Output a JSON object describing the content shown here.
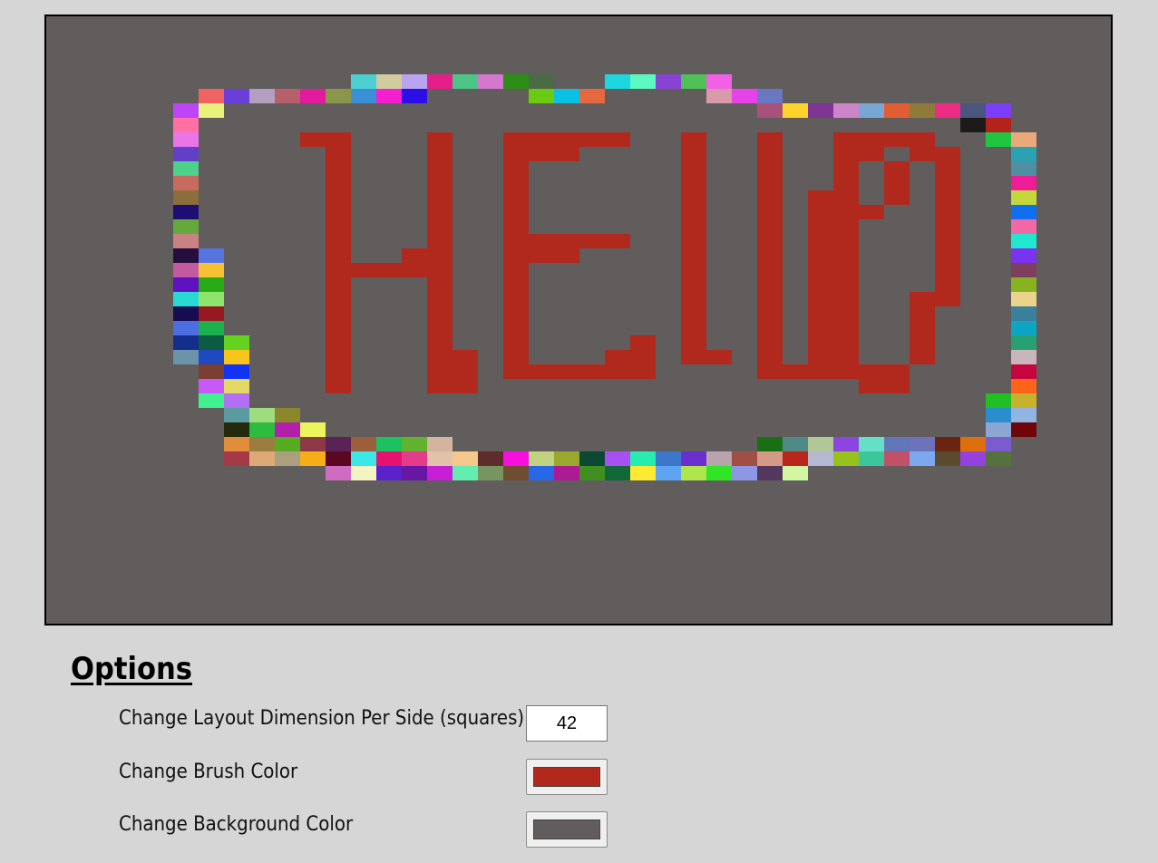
{
  "canvas": {
    "background_color": "#625d5d",
    "brush_color": "#b1281d",
    "cells": [
      {
        "col": 12,
        "row": 4,
        "color": "#4ccfd1"
      },
      {
        "col": 13,
        "row": 4,
        "color": "#d2cb9f"
      },
      {
        "col": 14,
        "row": 4,
        "color": "#b9a4f0"
      },
      {
        "col": 15,
        "row": 4,
        "color": "#e51f8a"
      },
      {
        "col": 16,
        "row": 4,
        "color": "#4cc587"
      },
      {
        "col": 17,
        "row": 4,
        "color": "#d576cf"
      },
      {
        "col": 18,
        "row": 4,
        "color": "#2e8d16"
      },
      {
        "col": 19,
        "row": 4,
        "color": "#4b6b45"
      },
      {
        "col": 22,
        "row": 4,
        "color": "#1dd7e0"
      },
      {
        "col": 23,
        "row": 4,
        "color": "#5cf9c3"
      },
      {
        "col": 24,
        "row": 4,
        "color": "#8843d5"
      },
      {
        "col": 25,
        "row": 4,
        "color": "#4fc157"
      },
      {
        "col": 26,
        "row": 4,
        "color": "#f260e6"
      },
      {
        "col": 6,
        "row": 5,
        "color": "#ef6363"
      },
      {
        "col": 7,
        "row": 5,
        "color": "#6a3fd9"
      },
      {
        "col": 8,
        "row": 5,
        "color": "#b29fc2"
      },
      {
        "col": 9,
        "row": 5,
        "color": "#b5606b"
      },
      {
        "col": 10,
        "row": 5,
        "color": "#e11a9e"
      },
      {
        "col": 11,
        "row": 5,
        "color": "#8a974b"
      },
      {
        "col": 12,
        "row": 5,
        "color": "#3a8fd7"
      },
      {
        "col": 13,
        "row": 5,
        "color": "#f41fce"
      },
      {
        "col": 14,
        "row": 5,
        "color": "#2b0fe6"
      },
      {
        "col": 19,
        "row": 5,
        "color": "#6bca12"
      },
      {
        "col": 20,
        "row": 5,
        "color": "#0cc0e3"
      },
      {
        "col": 21,
        "row": 5,
        "color": "#e46840"
      },
      {
        "col": 26,
        "row": 5,
        "color": "#d69aa9"
      },
      {
        "col": 27,
        "row": 5,
        "color": "#e642e8"
      },
      {
        "col": 28,
        "row": 5,
        "color": "#6a77c1"
      },
      {
        "col": 5,
        "row": 6,
        "color": "#bd44f7"
      },
      {
        "col": 6,
        "row": 6,
        "color": "#e8f27b"
      },
      {
        "col": 28,
        "row": 6,
        "color": "#a8527a"
      },
      {
        "col": 29,
        "row": 6,
        "color": "#ffd22c"
      },
      {
        "col": 30,
        "row": 6,
        "color": "#7e3593"
      },
      {
        "col": 31,
        "row": 6,
        "color": "#cc85c8"
      },
      {
        "col": 32,
        "row": 6,
        "color": "#7aa6d6"
      },
      {
        "col": 33,
        "row": 6,
        "color": "#e35d33"
      },
      {
        "col": 34,
        "row": 6,
        "color": "#8f7a39"
      },
      {
        "col": 35,
        "row": 6,
        "color": "#ee2c86"
      },
      {
        "col": 36,
        "row": 6,
        "color": "#4b5680"
      },
      {
        "col": 37,
        "row": 6,
        "color": "#7b3ef9"
      },
      {
        "col": 5,
        "row": 7,
        "color": "#ff6fa3"
      },
      {
        "col": 36,
        "row": 7,
        "color": "#1d1a1a"
      },
      {
        "col": 37,
        "row": 7,
        "color": "#b4221c"
      },
      {
        "col": 5,
        "row": 8,
        "color": "#e975e9"
      },
      {
        "col": 37,
        "row": 8,
        "color": "#20c640"
      },
      {
        "col": 38,
        "row": 8,
        "color": "#eaa97b"
      },
      {
        "col": 5,
        "row": 9,
        "color": "#6040c8"
      },
      {
        "col": 38,
        "row": 9,
        "color": "#2ba2b4"
      },
      {
        "col": 5,
        "row": 10,
        "color": "#4dd08a"
      },
      {
        "col": 38,
        "row": 10,
        "color": "#4e8fa1"
      },
      {
        "col": 5,
        "row": 11,
        "color": "#c96a61"
      },
      {
        "col": 38,
        "row": 11,
        "color": "#ee1c96"
      },
      {
        "col": 5,
        "row": 12,
        "color": "#8c6d3c"
      },
      {
        "col": 38,
        "row": 12,
        "color": "#c4d83b"
      },
      {
        "col": 5,
        "row": 13,
        "color": "#1e0e74"
      },
      {
        "col": 38,
        "row": 13,
        "color": "#0f6ff0"
      },
      {
        "col": 5,
        "row": 14,
        "color": "#66a83c"
      },
      {
        "col": 38,
        "row": 14,
        "color": "#f168a4"
      },
      {
        "col": 5,
        "row": 15,
        "color": "#c88283"
      },
      {
        "col": 38,
        "row": 15,
        "color": "#21e9cf"
      },
      {
        "col": 5,
        "row": 16,
        "color": "#250f3f"
      },
      {
        "col": 6,
        "row": 16,
        "color": "#5574e0"
      },
      {
        "col": 38,
        "row": 16,
        "color": "#7a33ef"
      },
      {
        "col": 5,
        "row": 17,
        "color": "#c15aa1"
      },
      {
        "col": 6,
        "row": 17,
        "color": "#f6c132"
      },
      {
        "col": 38,
        "row": 17,
        "color": "#7e3e5d"
      },
      {
        "col": 5,
        "row": 18,
        "color": "#5e12bf"
      },
      {
        "col": 6,
        "row": 18,
        "color": "#28a916"
      },
      {
        "col": 38,
        "row": 18,
        "color": "#88b321"
      },
      {
        "col": 5,
        "row": 19,
        "color": "#27dbd3"
      },
      {
        "col": 6,
        "row": 19,
        "color": "#8ee56d"
      },
      {
        "col": 38,
        "row": 19,
        "color": "#ebd38c"
      },
      {
        "col": 5,
        "row": 20,
        "color": "#180c51"
      },
      {
        "col": 6,
        "row": 20,
        "color": "#961820"
      },
      {
        "col": 38,
        "row": 20,
        "color": "#3a7f9b"
      },
      {
        "col": 5,
        "row": 21,
        "color": "#4d6ee0"
      },
      {
        "col": 6,
        "row": 21,
        "color": "#1eb04d"
      },
      {
        "col": 38,
        "row": 21,
        "color": "#0ea5c4"
      },
      {
        "col": 5,
        "row": 22,
        "color": "#142f8b"
      },
      {
        "col": 6,
        "row": 22,
        "color": "#0d5b43"
      },
      {
        "col": 7,
        "row": 22,
        "color": "#64d21e"
      },
      {
        "col": 38,
        "row": 22,
        "color": "#27a074"
      },
      {
        "col": 5,
        "row": 23,
        "color": "#6b93a9"
      },
      {
        "col": 6,
        "row": 23,
        "color": "#2049c1"
      },
      {
        "col": 7,
        "row": 23,
        "color": "#fac51a"
      },
      {
        "col": 38,
        "row": 23,
        "color": "#c9b6bc"
      },
      {
        "col": 6,
        "row": 24,
        "color": "#7b3f31"
      },
      {
        "col": 7,
        "row": 24,
        "color": "#1232f4"
      },
      {
        "col": 38,
        "row": 24,
        "color": "#c5053d"
      },
      {
        "col": 6,
        "row": 25,
        "color": "#c659f7"
      },
      {
        "col": 7,
        "row": 25,
        "color": "#e2d966"
      },
      {
        "col": 38,
        "row": 25,
        "color": "#fd6419"
      },
      {
        "col": 6,
        "row": 26,
        "color": "#3ef18e"
      },
      {
        "col": 7,
        "row": 26,
        "color": "#b26ff3"
      },
      {
        "col": 37,
        "row": 26,
        "color": "#20c025"
      },
      {
        "col": 38,
        "row": 26,
        "color": "#c7b22e"
      },
      {
        "col": 7,
        "row": 27,
        "color": "#5a9aa0"
      },
      {
        "col": 8,
        "row": 27,
        "color": "#9ddc7f"
      },
      {
        "col": 9,
        "row": 27,
        "color": "#8b872a"
      },
      {
        "col": 37,
        "row": 27,
        "color": "#2a8ecd"
      },
      {
        "col": 38,
        "row": 27,
        "color": "#91b4e2"
      },
      {
        "col": 7,
        "row": 28,
        "color": "#262a0d"
      },
      {
        "col": 8,
        "row": 28,
        "color": "#2bbc40"
      },
      {
        "col": 9,
        "row": 28,
        "color": "#b21fa8"
      },
      {
        "col": 10,
        "row": 28,
        "color": "#ecf65c"
      },
      {
        "col": 37,
        "row": 28,
        "color": "#8ba6d2"
      },
      {
        "col": 38,
        "row": 28,
        "color": "#6f0509"
      },
      {
        "col": 7,
        "row": 29,
        "color": "#e08e3b"
      },
      {
        "col": 8,
        "row": 29,
        "color": "#9b7c41"
      },
      {
        "col": 9,
        "row": 29,
        "color": "#55ac21"
      },
      {
        "col": 10,
        "row": 29,
        "color": "#8d3a46"
      },
      {
        "col": 11,
        "row": 29,
        "color": "#5b2256"
      },
      {
        "col": 12,
        "row": 29,
        "color": "#9d5e3b"
      },
      {
        "col": 13,
        "row": 29,
        "color": "#1cc162"
      },
      {
        "col": 14,
        "row": 29,
        "color": "#62b230"
      },
      {
        "col": 15,
        "row": 29,
        "color": "#d4b49f"
      },
      {
        "col": 28,
        "row": 29,
        "color": "#1a6e14"
      },
      {
        "col": 29,
        "row": 29,
        "color": "#4f8a86"
      },
      {
        "col": 30,
        "row": 29,
        "color": "#b1c797"
      },
      {
        "col": 31,
        "row": 29,
        "color": "#8c45de"
      },
      {
        "col": 32,
        "row": 29,
        "color": "#63e0c5"
      },
      {
        "col": 33,
        "row": 29,
        "color": "#6276b8"
      },
      {
        "col": 34,
        "row": 29,
        "color": "#6d72bb"
      },
      {
        "col": 35,
        "row": 29,
        "color": "#6c2412"
      },
      {
        "col": 36,
        "row": 29,
        "color": "#dc6f0b"
      },
      {
        "col": 37,
        "row": 29,
        "color": "#7a5ccf"
      },
      {
        "col": 7,
        "row": 30,
        "color": "#a43a48"
      },
      {
        "col": 8,
        "row": 30,
        "color": "#ddaa77"
      },
      {
        "col": 9,
        "row": 30,
        "color": "#ac9f7e"
      },
      {
        "col": 10,
        "row": 30,
        "color": "#f7ae16"
      },
      {
        "col": 11,
        "row": 30,
        "color": "#5c0722"
      },
      {
        "col": 12,
        "row": 30,
        "color": "#3ae8e8"
      },
      {
        "col": 13,
        "row": 30,
        "color": "#e5126f"
      },
      {
        "col": 14,
        "row": 30,
        "color": "#e43c8a"
      },
      {
        "col": 15,
        "row": 30,
        "color": "#e0c3aa"
      },
      {
        "col": 16,
        "row": 30,
        "color": "#f6c88c"
      },
      {
        "col": 17,
        "row": 30,
        "color": "#5e2d2b"
      },
      {
        "col": 18,
        "row": 30,
        "color": "#f710dd"
      },
      {
        "col": 19,
        "row": 30,
        "color": "#c1d37f"
      },
      {
        "col": 20,
        "row": 30,
        "color": "#9aa92d"
      },
      {
        "col": 21,
        "row": 30,
        "color": "#0c4933"
      },
      {
        "col": 22,
        "row": 30,
        "color": "#a950f4"
      },
      {
        "col": 23,
        "row": 30,
        "color": "#27ecaf"
      },
      {
        "col": 24,
        "row": 30,
        "color": "#3c77cb"
      },
      {
        "col": 25,
        "row": 30,
        "color": "#6a2fcf"
      },
      {
        "col": 26,
        "row": 30,
        "color": "#b9a3ad"
      },
      {
        "col": 27,
        "row": 30,
        "color": "#a14f43"
      },
      {
        "col": 28,
        "row": 30,
        "color": "#d59a87"
      },
      {
        "col": 29,
        "row": 30,
        "color": "#b8261c"
      },
      {
        "col": 30,
        "row": 30,
        "color": "#b4b8d0"
      },
      {
        "col": 31,
        "row": 30,
        "color": "#96c21b"
      },
      {
        "col": 32,
        "row": 30,
        "color": "#3dc69b"
      },
      {
        "col": 33,
        "row": 30,
        "color": "#c15167"
      },
      {
        "col": 34,
        "row": 30,
        "color": "#7ba8ee"
      },
      {
        "col": 35,
        "row": 30,
        "color": "#5a4a2e"
      },
      {
        "col": 36,
        "row": 30,
        "color": "#9342dd"
      },
      {
        "col": 37,
        "row": 30,
        "color": "#55713d"
      },
      {
        "col": 11,
        "row": 31,
        "color": "#ce6cc1"
      },
      {
        "col": 12,
        "row": 31,
        "color": "#f2f4c1"
      },
      {
        "col": 13,
        "row": 31,
        "color": "#5a22cd"
      },
      {
        "col": 14,
        "row": 31,
        "color": "#6816a4"
      },
      {
        "col": 15,
        "row": 31,
        "color": "#c71fd5"
      },
      {
        "col": 16,
        "row": 31,
        "color": "#63edb0"
      },
      {
        "col": 17,
        "row": 31,
        "color": "#779462"
      },
      {
        "col": 18,
        "row": 31,
        "color": "#6f4d31"
      },
      {
        "col": 19,
        "row": 31,
        "color": "#2867e8"
      },
      {
        "col": 20,
        "row": 31,
        "color": "#ad1a94"
      },
      {
        "col": 21,
        "row": 31,
        "color": "#3f9020"
      },
      {
        "col": 22,
        "row": 31,
        "color": "#116839"
      },
      {
        "col": 23,
        "row": 31,
        "color": "#fcea33"
      },
      {
        "col": 24,
        "row": 31,
        "color": "#5ea4f3"
      },
      {
        "col": 25,
        "row": 31,
        "color": "#aee54b"
      },
      {
        "col": 26,
        "row": 31,
        "color": "#30e525"
      },
      {
        "col": 27,
        "row": 31,
        "color": "#8e96e6"
      },
      {
        "col": 28,
        "row": 31,
        "color": "#54375d"
      },
      {
        "col": 29,
        "row": 31,
        "color": "#d3f7a0"
      }
    ],
    "brush_cells": [
      {
        "row": 8,
        "cols": [
          10,
          11,
          15,
          18,
          19,
          20,
          21,
          22,
          25,
          28,
          31,
          32,
          33,
          34
        ]
      },
      {
        "row": 9,
        "cols": [
          11,
          15,
          18,
          19,
          20,
          25,
          28,
          31,
          32,
          34,
          35
        ]
      },
      {
        "row": 10,
        "cols": [
          11,
          15,
          18,
          25,
          28,
          31,
          33,
          35
        ]
      },
      {
        "row": 11,
        "cols": [
          11,
          15,
          18,
          25,
          28,
          31,
          33,
          35
        ]
      },
      {
        "row": 12,
        "cols": [
          11,
          15,
          18,
          25,
          28,
          30,
          31,
          33,
          35
        ]
      },
      {
        "row": 13,
        "cols": [
          11,
          15,
          18,
          25,
          28,
          30,
          31,
          32,
          35
        ]
      },
      {
        "row": 14,
        "cols": [
          11,
          15,
          18,
          25,
          28,
          30,
          31,
          35
        ]
      },
      {
        "row": 15,
        "cols": [
          11,
          15,
          18,
          19,
          20,
          21,
          22,
          25,
          28,
          30,
          31,
          35
        ]
      },
      {
        "row": 16,
        "cols": [
          11,
          14,
          15,
          18,
          19,
          20,
          25,
          28,
          30,
          31,
          35
        ]
      },
      {
        "row": 17,
        "cols": [
          11,
          12,
          13,
          14,
          15,
          18,
          25,
          28,
          30,
          31,
          35
        ]
      },
      {
        "row": 18,
        "cols": [
          11,
          15,
          18,
          25,
          28,
          30,
          31,
          35
        ]
      },
      {
        "row": 19,
        "cols": [
          11,
          15,
          18,
          25,
          28,
          30,
          31,
          34,
          35
        ]
      },
      {
        "row": 20,
        "cols": [
          11,
          15,
          18,
          25,
          28,
          30,
          31,
          34
        ]
      },
      {
        "row": 21,
        "cols": [
          11,
          15,
          18,
          25,
          28,
          30,
          31,
          34
        ]
      },
      {
        "row": 22,
        "cols": [
          11,
          15,
          18,
          23,
          25,
          28,
          30,
          31,
          34
        ]
      },
      {
        "row": 23,
        "cols": [
          11,
          15,
          16,
          18,
          22,
          23,
          25,
          26,
          28,
          30,
          31,
          34
        ]
      },
      {
        "row": 24,
        "cols": [
          11,
          15,
          16,
          18,
          19,
          20,
          21,
          22,
          23,
          28,
          29,
          30,
          31,
          32,
          33
        ]
      },
      {
        "row": 25,
        "cols": [
          11,
          15,
          16,
          32,
          33
        ]
      }
    ]
  },
  "options": {
    "title": "Options",
    "dimension_label": "Change Layout Dimension Per Side (squares)",
    "dimension_value": "42",
    "brush_label": "Change Brush Color",
    "brush_color": "#b1281d",
    "background_label": "Change Background Color",
    "background_color": "#625d5d"
  }
}
